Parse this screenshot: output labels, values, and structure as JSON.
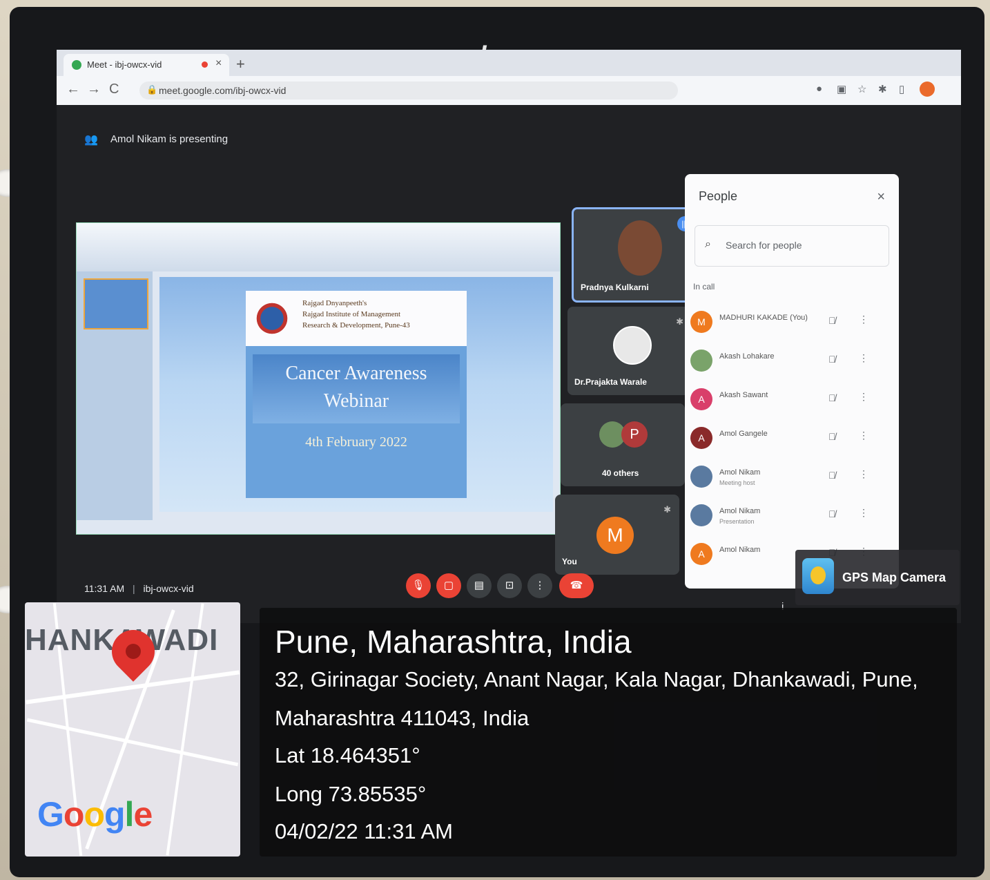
{
  "monitor": {
    "brand": "lenovo"
  },
  "browser": {
    "tab_title": "Meet - ibj-owcx-vid",
    "tab_close": "×",
    "new_tab": "+",
    "back": "←",
    "forward": "→",
    "reload": "C",
    "url": "meet.google.com/ibj-owcx-vid"
  },
  "meet": {
    "presenting_text": "Amol Nikam is presenting",
    "time": "11:31 AM",
    "separator": "|",
    "meeting_code": "ibj-owcx-vid",
    "info_icon": "i"
  },
  "slide": {
    "institution_lines": [
      "Rajgad Dnyanpeeth's",
      "Rajgad Institute of Management",
      "Research & Development, Pune-43"
    ],
    "title_line1": "Cancer Awareness",
    "title_line2": "Webinar",
    "date": "4th February 2022"
  },
  "tiles": {
    "t1_name": "Pradnya Kulkarni",
    "t2_name": "Dr.Prajakta Warale",
    "t3_initial": "P",
    "t3_label": "40 others",
    "t4_initial": "M",
    "t4_label": "You"
  },
  "people_panel": {
    "title": "People",
    "close": "×",
    "search_placeholder": "Search for people",
    "section": "In call",
    "participants": [
      {
        "initial": "M",
        "name": "MADHURI KAKADE (You)",
        "sub": "",
        "color": "#ef7a1f"
      },
      {
        "initial": "",
        "name": "Akash Lohakare",
        "sub": "",
        "color": "#7aa36a"
      },
      {
        "initial": "A",
        "name": "Akash Sawant",
        "sub": "",
        "color": "#d93f6a"
      },
      {
        "initial": "A",
        "name": "Amol Gangele",
        "sub": "",
        "color": "#8a2a2a"
      },
      {
        "initial": "",
        "name": "Amol Nikam",
        "sub": "Meeting host",
        "color": "#5a7aa0"
      },
      {
        "initial": "",
        "name": "Amol Nikam",
        "sub": "Presentation",
        "color": "#5a7aa0"
      },
      {
        "initial": "A",
        "name": "Amol Nikam",
        "sub": "",
        "color": "#ef7a1f"
      }
    ]
  },
  "geotag": {
    "app_name": "GPS Map Camera",
    "city": "Pune, Maharashtra, India",
    "address_line1": "32, Girinagar Society, Anant Nagar, Kala Nagar, Dhankawadi, Pune,",
    "address_line2": "Maharashtra 411043, India",
    "lat": "Lat 18.464351°",
    "long": "Long 73.85535°",
    "datetime": "04/02/22 11:31 AM",
    "map_area_label": "HANKAWADI",
    "map_logo": "Google"
  }
}
